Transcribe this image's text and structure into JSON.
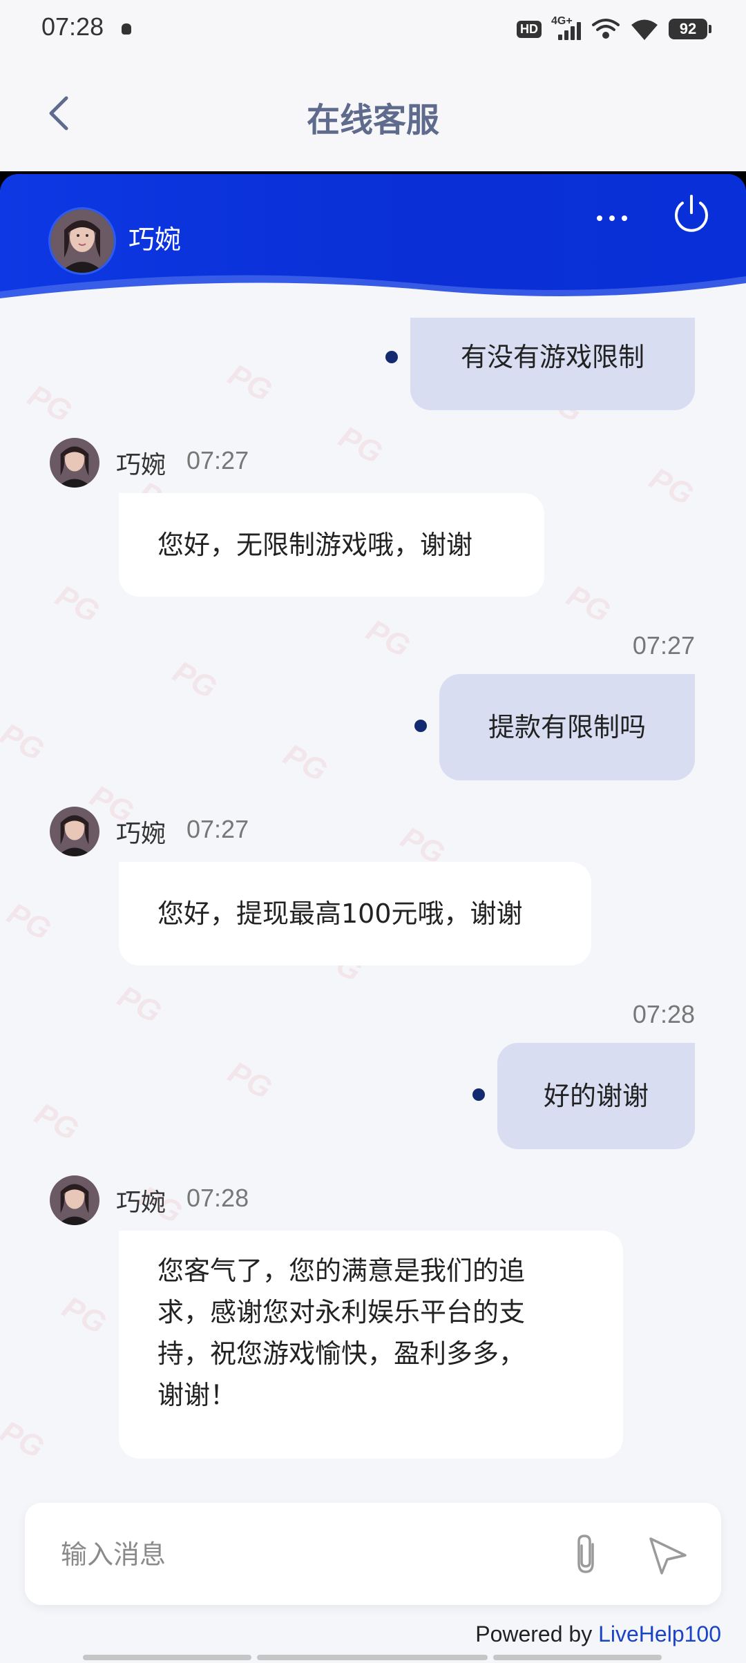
{
  "status_bar": {
    "time": "07:28",
    "hd": "HD",
    "network": "4G+",
    "battery": "92"
  },
  "header": {
    "title": "在线客服"
  },
  "chat_header": {
    "agent_name": "巧婉"
  },
  "messages": [
    {
      "from": "user",
      "text": "有没有游戏限制"
    },
    {
      "from": "agent",
      "name": "巧婉",
      "time": "07:27",
      "text": "您好，无限制游戏哦，谢谢"
    },
    {
      "from": "user",
      "time": "07:27",
      "text": "提款有限制吗"
    },
    {
      "from": "agent",
      "name": "巧婉",
      "time": "07:27",
      "text": "您好，提现最高100元哦，谢谢"
    },
    {
      "from": "user",
      "time": "07:28",
      "text": "好的谢谢"
    },
    {
      "from": "agent",
      "name": "巧婉",
      "time": "07:28",
      "lines": [
        "您客气了，您的满意是我们的追",
        "求，感谢您对永利娱乐平台的支",
        "持，祝您游戏愉快，盈利多多，",
        "谢谢！"
      ]
    }
  ],
  "input": {
    "placeholder": "输入消息"
  },
  "footer": {
    "powered_prefix": "Powered by",
    "powered_brand": "LiveHelp100"
  },
  "watermark": "PG"
}
